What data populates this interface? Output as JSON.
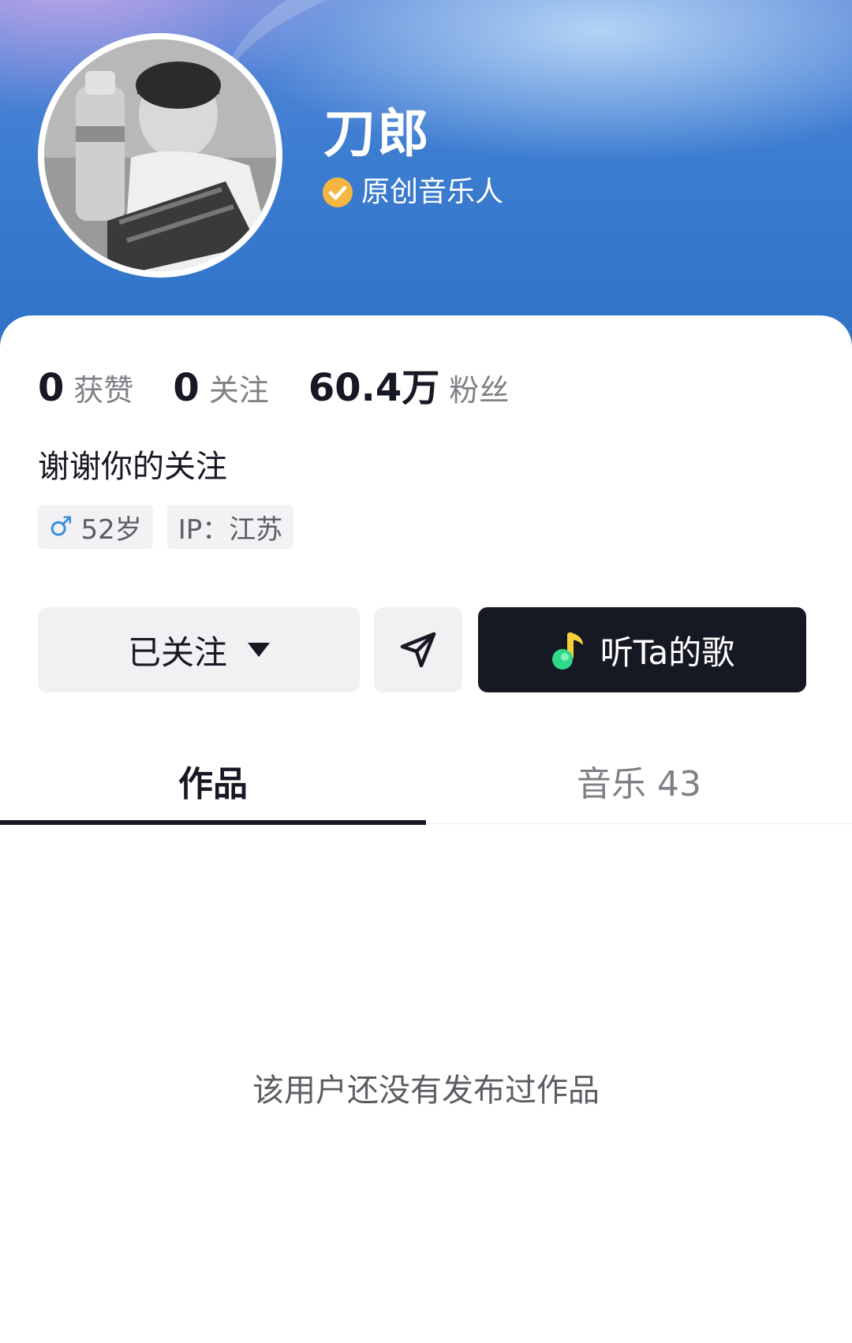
{
  "profile": {
    "name": "刀郎",
    "verification": "原创音乐人",
    "bio": "谢谢你的关注"
  },
  "stats": {
    "likes": {
      "count": "0",
      "label": "获赞"
    },
    "following": {
      "count": "0",
      "label": "关注"
    },
    "followers": {
      "count": "60.4万",
      "label": "粉丝"
    }
  },
  "tags": {
    "age": "52岁",
    "ip": "IP：江苏"
  },
  "actions": {
    "follow_label": "已关注",
    "music_label": "听Ta的歌"
  },
  "tabs": [
    {
      "label": "作品"
    },
    {
      "label": "音乐 43"
    }
  ],
  "empty_state": "该用户还没有发布过作品",
  "colors": {
    "header_blue": "#3c7dd0",
    "verify_badge": "#f5b641",
    "dark_button": "#161823",
    "music_note_green": "#2fd98a",
    "male_icon": "#3a8fd9"
  },
  "icons": {
    "verify": "verified-check-icon",
    "caret": "caret-down-icon",
    "message": "paper-plane-icon",
    "music": "music-note-icon",
    "gender": "male-icon"
  }
}
